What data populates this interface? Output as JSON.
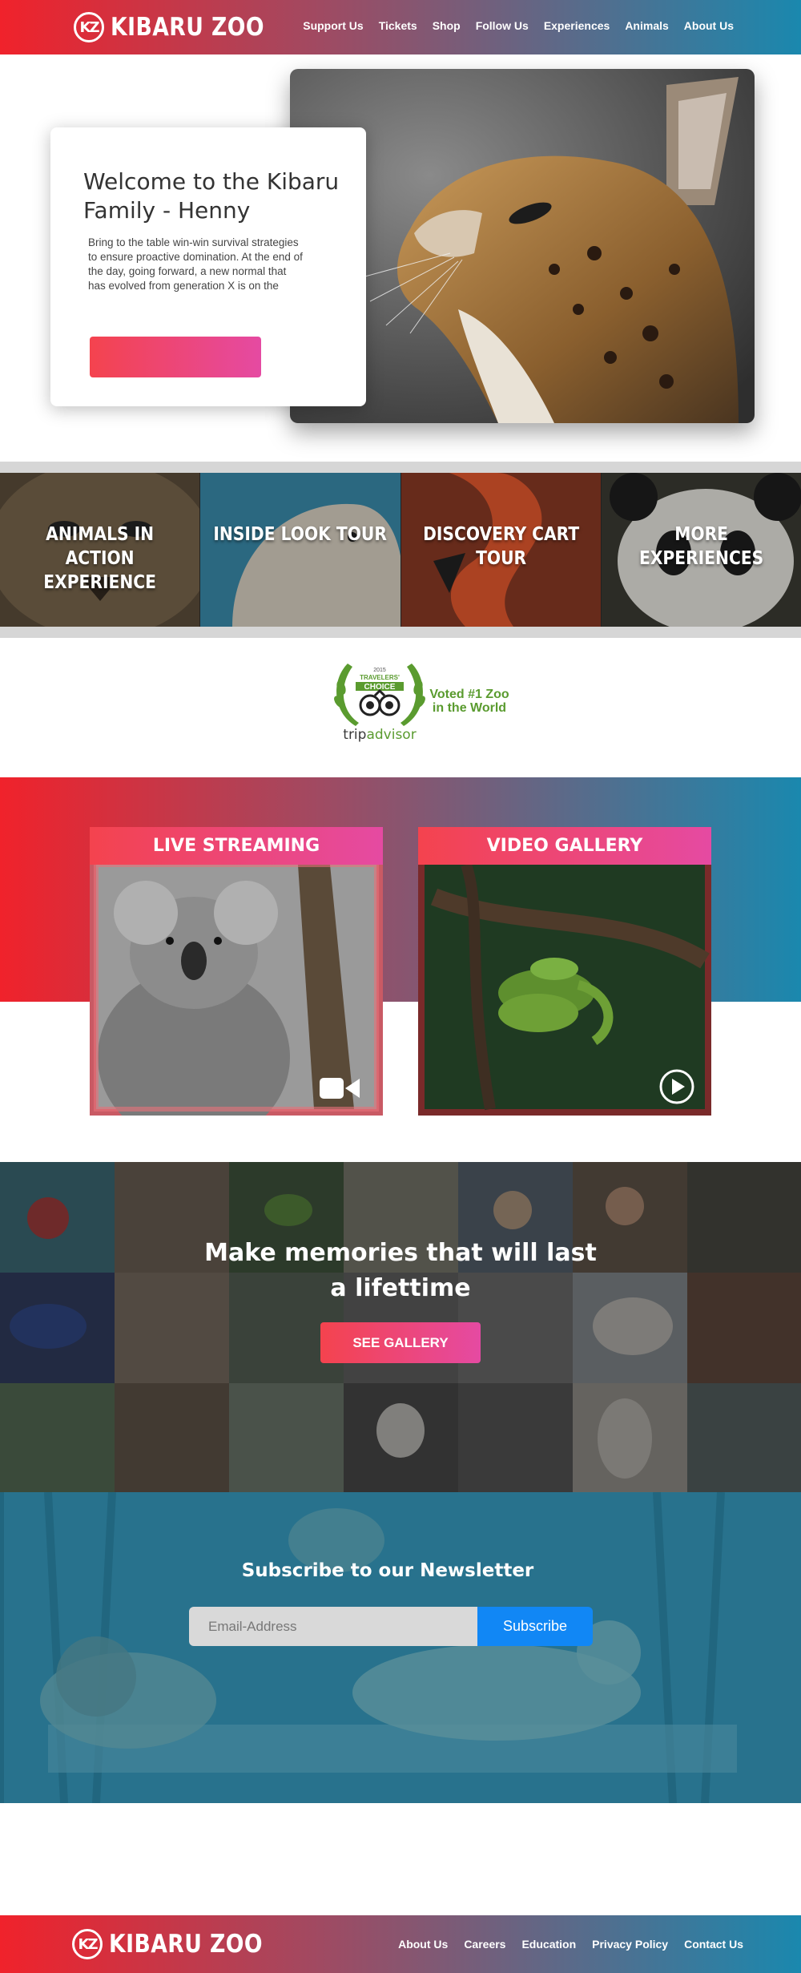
{
  "brand": {
    "name": "KIBARU ZOO",
    "logo_mark": "KZ"
  },
  "header": {
    "nav": [
      "Support Us",
      "Tickets",
      "Shop",
      "Follow Us",
      "Experiences",
      "Animals",
      "About Us"
    ]
  },
  "hero": {
    "title": "Welcome to the Kibaru Family - Henny",
    "body": "Bring to the table win-win survival strategies to ensure proactive domination. At the end of the day, going forward, a new normal that has evolved from generation X is on the",
    "button_label": ""
  },
  "experiences": [
    {
      "label": "ANIMALS IN ACTION EXPERIENCE"
    },
    {
      "label": "INSIDE LOOK TOUR"
    },
    {
      "label": "DISCOVERY CART TOUR"
    },
    {
      "label": "MORE EXPERIENCES"
    }
  ],
  "award": {
    "year": "2015",
    "badge_line1": "TRAVELERS'",
    "badge_line2": "CHOICE",
    "brand_a": "trip",
    "brand_b": "advisor",
    "tagline": "Voted #1 Zoo in the World"
  },
  "media": {
    "live": {
      "title": "LIVE STREAMING",
      "icon": "video-camera-icon"
    },
    "gallery": {
      "title": "VIDEO  GALLERY",
      "icon": "play-circle-icon"
    }
  },
  "memories": {
    "heading": "Make memories that will last a lifettime",
    "button_label": "SEE GALLERY"
  },
  "newsletter": {
    "title": "Subscribe to our Newsletter",
    "email_placeholder": "Email-Address",
    "button_label": "Subscribe"
  },
  "footer": {
    "nav": [
      "About Us",
      "Careers",
      "Education",
      "Privacy Policy",
      "Contact Us"
    ]
  },
  "colors": {
    "brand_red": "#f0222b",
    "brand_teal": "#1a88ae",
    "button_pink": "#e54aa2",
    "subscribe_blue": "#1187f5"
  }
}
